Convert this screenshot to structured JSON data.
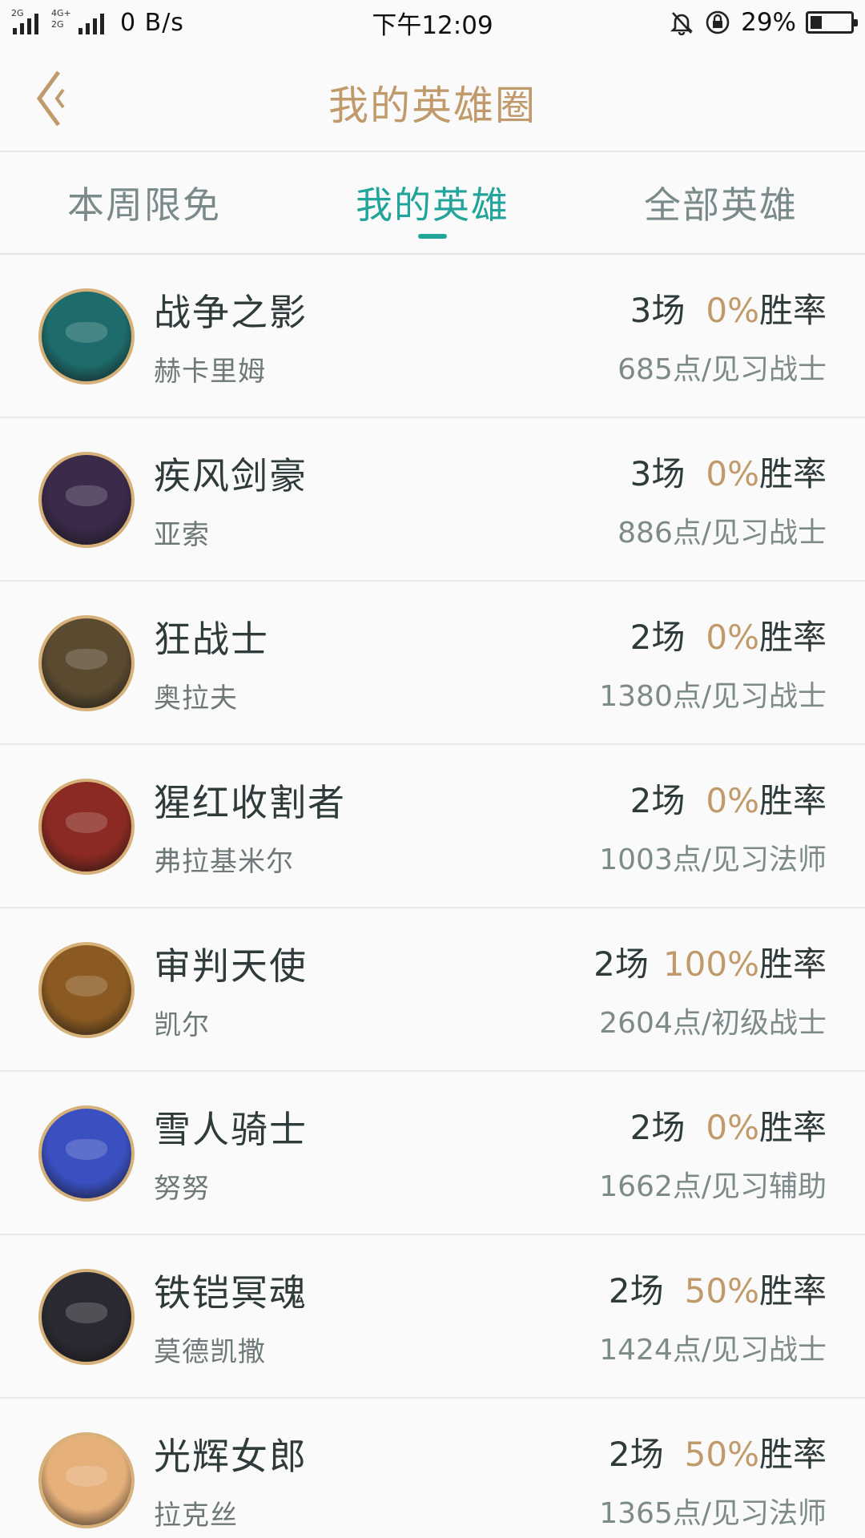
{
  "status_bar": {
    "sim1_label": "2G",
    "sim2_label_top": "4G+",
    "sim2_label_bottom": "2G",
    "net_speed": "0 B/s",
    "time": "下午12:09",
    "battery": "29%",
    "battery_level": 0.29,
    "icons": [
      "signal-icon",
      "signal-icon",
      "bell-muted-icon",
      "rotation-lock-icon",
      "battery-icon"
    ]
  },
  "header": {
    "title": "我的英雄圈",
    "back_icon": "chevron-left-icon",
    "accent": "#c19a6b"
  },
  "tabs": [
    {
      "label": "本周限免",
      "active": false
    },
    {
      "label": "我的英雄",
      "active": true
    },
    {
      "label": "全部英雄",
      "active": false
    }
  ],
  "colors": {
    "tab_active": "#21a59a",
    "win_rate": "#c19a6b",
    "text": "#2f3b3b",
    "sub": "#7d8a8a"
  },
  "heroes": [
    {
      "name": "战争之影",
      "alias": "赫卡里姆",
      "games": "3场",
      "win_pct": "0%",
      "win_label": "胜率",
      "points": "685点/见习战士",
      "avatar_color": "#1d6b6a"
    },
    {
      "name": "疾风剑豪",
      "alias": "亚索",
      "games": "3场",
      "win_pct": "0%",
      "win_label": "胜率",
      "points": "886点/见习战士",
      "avatar_color": "#3b2a4a"
    },
    {
      "name": "狂战士",
      "alias": "奥拉夫",
      "games": "2场",
      "win_pct": "0%",
      "win_label": "胜率",
      "points": "1380点/见习战士",
      "avatar_color": "#5a4a30"
    },
    {
      "name": "猩红收割者",
      "alias": "弗拉基米尔",
      "games": "2场",
      "win_pct": "0%",
      "win_label": "胜率",
      "points": "1003点/见习法师",
      "avatar_color": "#8a2a22"
    },
    {
      "name": "审判天使",
      "alias": "凯尔",
      "games": "2场",
      "win_pct": "100%",
      "win_label": "胜率",
      "points": "2604点/初级战士",
      "avatar_color": "#8a5a22"
    },
    {
      "name": "雪人骑士",
      "alias": "努努",
      "games": "2场",
      "win_pct": "0%",
      "win_label": "胜率",
      "points": "1662点/见习辅助",
      "avatar_color": "#3a4fc0"
    },
    {
      "name": "铁铠冥魂",
      "alias": "莫德凯撒",
      "games": "2场",
      "win_pct": "50%",
      "win_label": "胜率",
      "points": "1424点/见习战士",
      "avatar_color": "#2a2a33"
    },
    {
      "name": "光辉女郎",
      "alias": "拉克丝",
      "games": "2场",
      "win_pct": "50%",
      "win_label": "胜率",
      "points": "1365点/见习法师",
      "avatar_color": "#e6b07a"
    }
  ]
}
